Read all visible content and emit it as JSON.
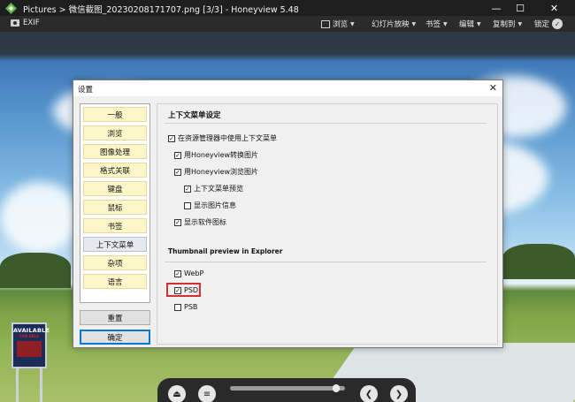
{
  "window": {
    "title": "Pictures > 微信截图_20230208171707.png [3/3] - Honeyview 5.48",
    "min": "—",
    "max": "☐",
    "close": "✕"
  },
  "toolbar": {
    "exif": "EXIF",
    "menus": [
      "浏览",
      "幻灯片放映",
      "书签",
      "编辑",
      "复制到",
      "锁定"
    ]
  },
  "sign": {
    "line1": "AVAILABLE",
    "line2": "FOR SALE"
  },
  "dialog": {
    "title": "设置",
    "close": "✕",
    "nav": [
      "一般",
      "浏览",
      "图像处理",
      "格式关联",
      "键盘",
      "鼠标",
      "书签",
      "上下文菜单",
      "杂项",
      "语言"
    ],
    "active_nav": "上下文菜单",
    "reset_button": "重置",
    "ok_button": "确定",
    "section1_title": "上下文菜单设定",
    "options": {
      "use_context_menu": "在资源管理器中使用上下文菜单",
      "convert_with": "用Honeyview转换图片",
      "browse_with": "用Honeyview浏览图片",
      "preview": "上下文菜单预览",
      "show_info": "显示图片信息",
      "show_icon": "显示软件图标"
    },
    "section2_title": "Thumbnail preview in Explorer",
    "thumbs": {
      "webp": "WebP",
      "psd": "PSD",
      "psb": "PSB"
    },
    "checked_mark": "✓"
  },
  "bottom_nav": {
    "eject": "⏏",
    "menu": "≡",
    "prev": "❮",
    "next": "❯",
    "slider_position": 0.95
  },
  "colors": {
    "nav_item_bg": "#fdf6c9",
    "highlight_border": "#d32f2f",
    "default_button_border": "#0078d7"
  }
}
